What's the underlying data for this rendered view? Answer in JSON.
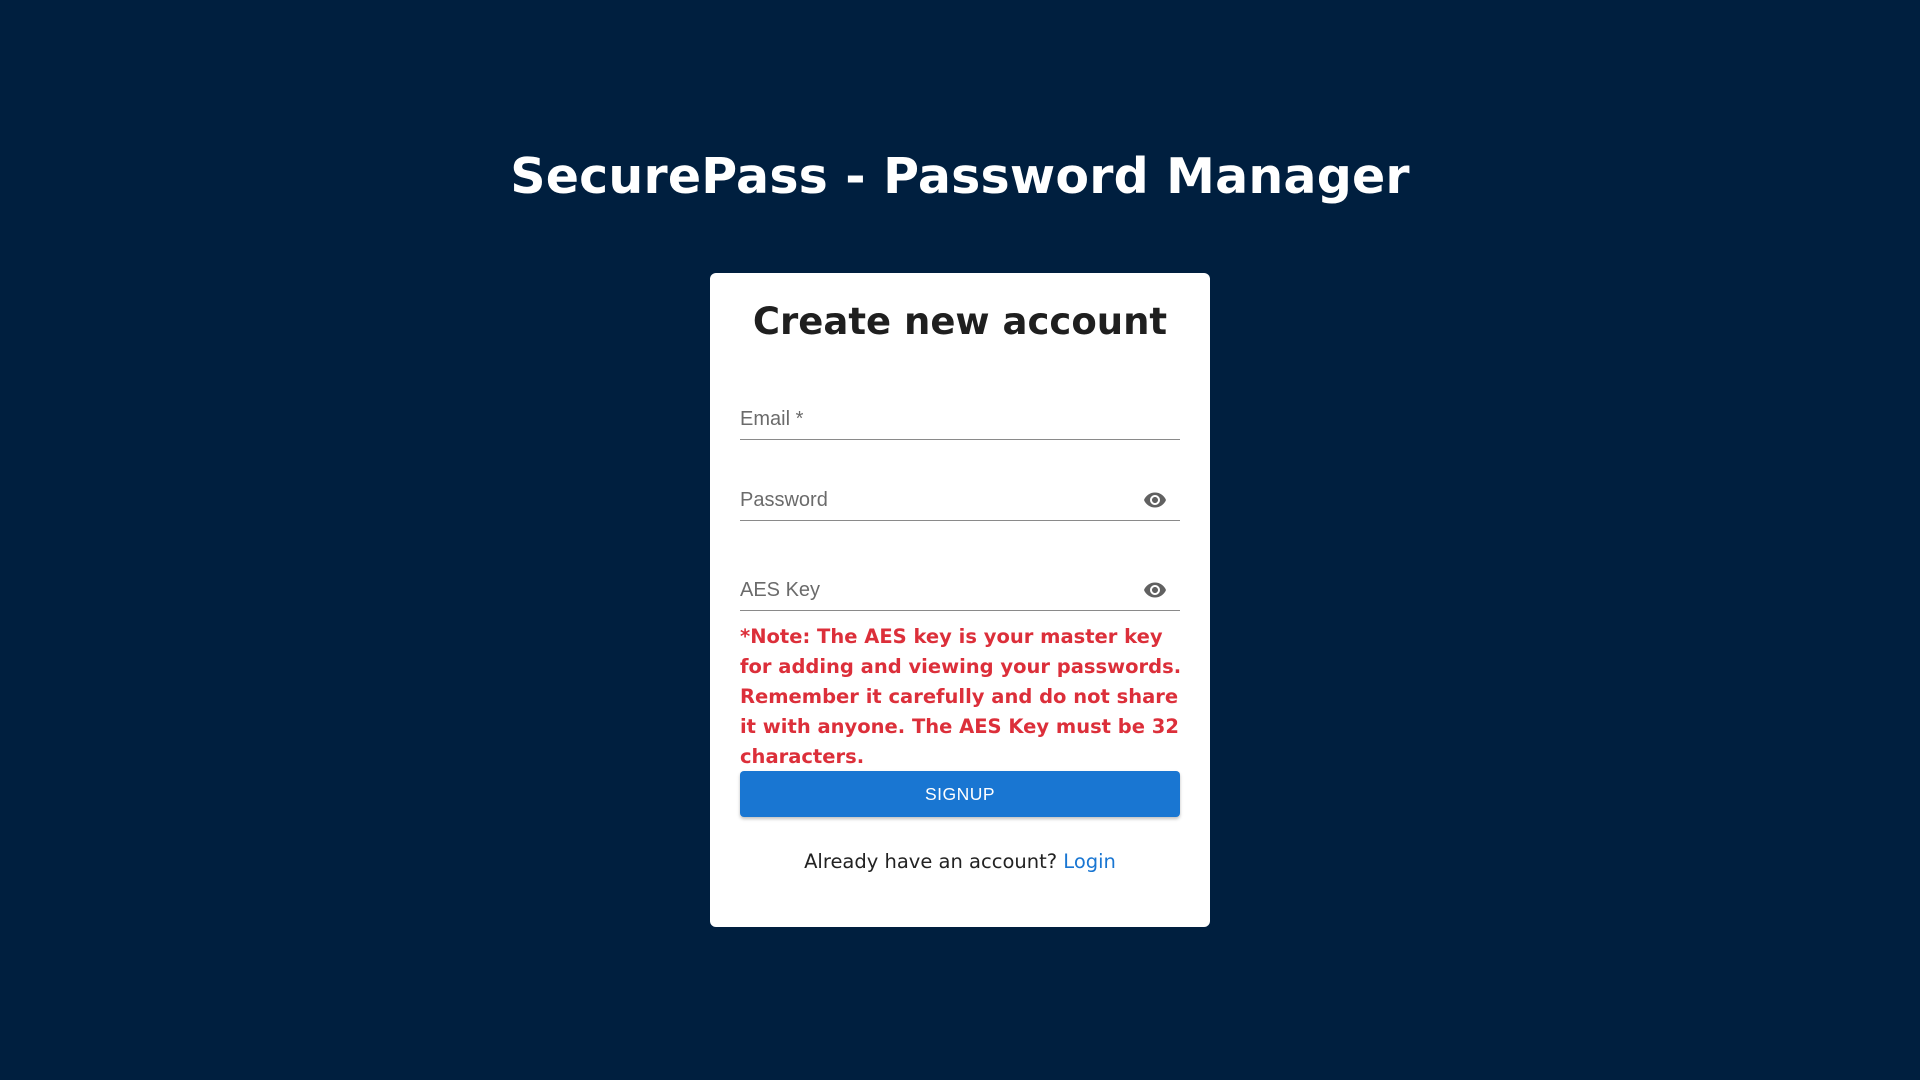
{
  "header": {
    "title": "SecurePass - Password Manager"
  },
  "form": {
    "heading": "Create new account",
    "email": {
      "placeholder": "Email *",
      "value": ""
    },
    "password": {
      "placeholder": "Password",
      "value": "",
      "toggle_icon": "eye-icon"
    },
    "aes_key": {
      "placeholder": "AES Key",
      "value": "",
      "toggle_icon": "eye-icon"
    },
    "note": "*Note: The AES key is your master key for adding and viewing your passwords. Remember it carefully and do not share it with anyone. The AES Key must be 32 characters.",
    "submit_label": "SIGNUP",
    "login_prompt": "Already have an account?",
    "login_link": "Login"
  },
  "colors": {
    "background": "#001f3f",
    "card": "#ffffff",
    "accent": "#1976d2",
    "note": "#dc2f3a"
  }
}
